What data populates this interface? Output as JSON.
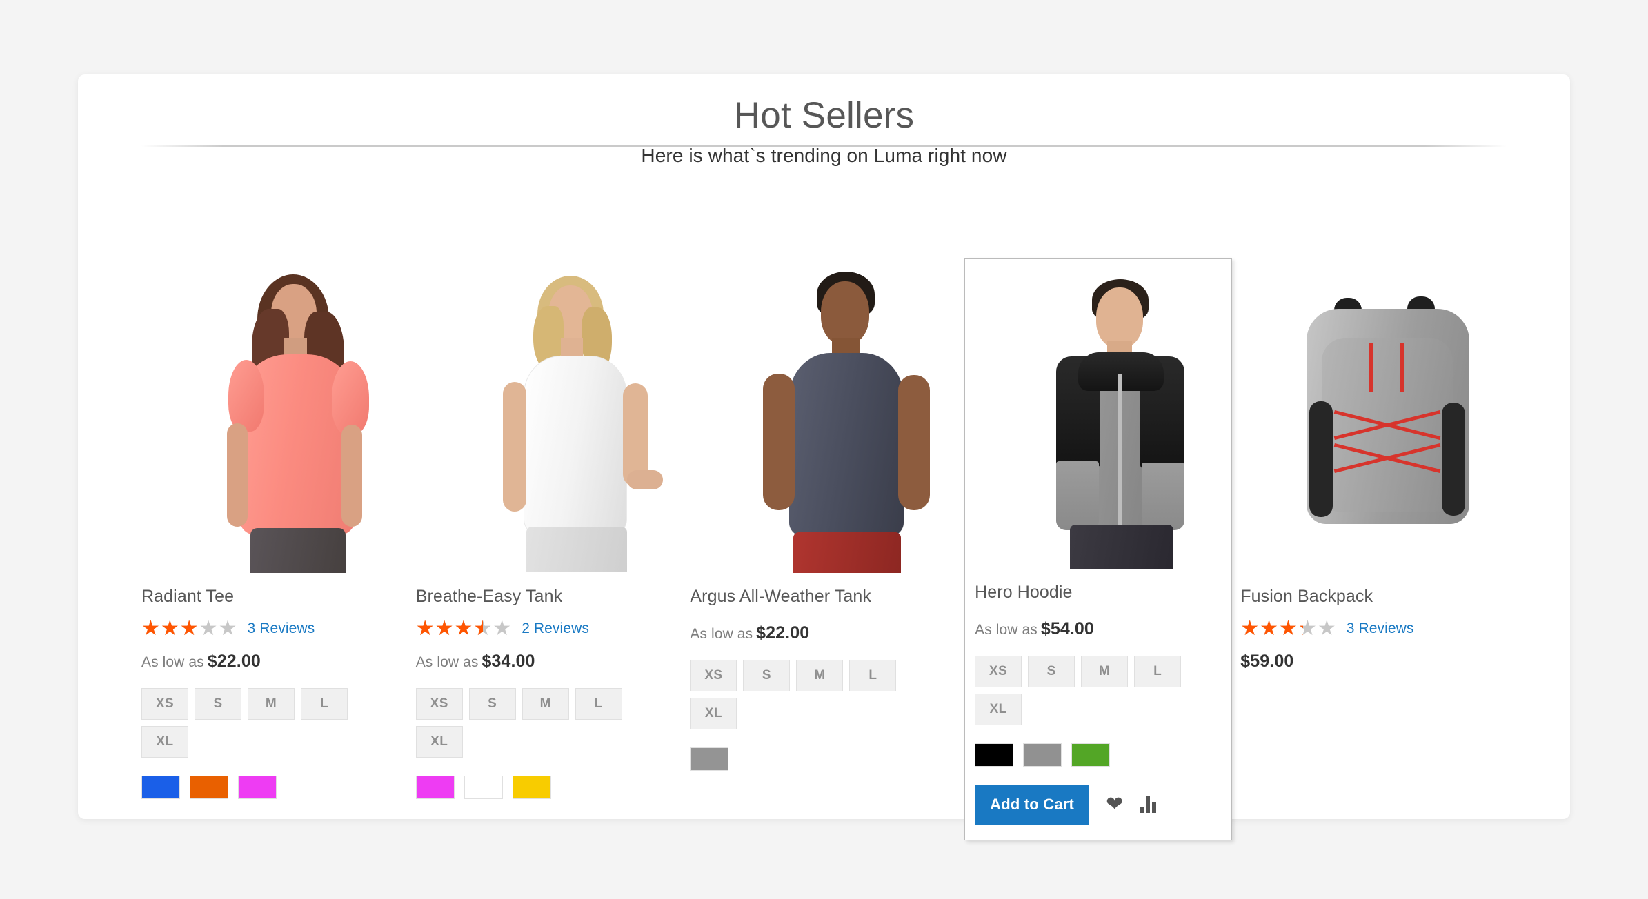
{
  "widget": {
    "title": "Hot Sellers",
    "subtitle": "Here is what`s trending on Luma right now"
  },
  "labels": {
    "as_low_as": "As low as",
    "reviews_suffix": "Reviews",
    "add_to_cart": "Add to Cart",
    "wishlist_icon": "heart-icon",
    "compare_icon": "compare-bars-icon"
  },
  "colors": {
    "accent_blue": "#1979c3",
    "star_orange": "#ff5501",
    "star_grey": "#c7c7c7",
    "link_blue": "#1979c3",
    "title_grey": "#575757",
    "page_bg": "#f4f4f4",
    "swatch_bg": "#f0f0f0"
  },
  "products": [
    {
      "name": "Radiant Tee",
      "rating_percent": 60,
      "review_count": "3",
      "has_rating": true,
      "price_label": "As low as",
      "price": "$22.00",
      "sizes": [
        "XS",
        "S",
        "M",
        "L",
        "XL"
      ],
      "colors": [
        "#1a5fe8",
        "#e96000",
        "#ee3cf3"
      ],
      "hovered": false
    },
    {
      "name": "Breathe-Easy Tank",
      "rating_percent": 70,
      "review_count": "2",
      "has_rating": true,
      "price_label": "As low as",
      "price": "$34.00",
      "sizes": [
        "XS",
        "S",
        "M",
        "L",
        "XL"
      ],
      "colors": [
        "#ee3cf3",
        "#ffffff",
        "#f8cc00"
      ],
      "hovered": false
    },
    {
      "name": "Argus All-Weather Tank",
      "rating_percent": 0,
      "review_count": "",
      "has_rating": false,
      "price_label": "As low as",
      "price": "$22.00",
      "sizes": [
        "XS",
        "S",
        "M",
        "L",
        "XL"
      ],
      "colors": [
        "#949494"
      ],
      "hovered": false
    },
    {
      "name": "Hero Hoodie",
      "rating_percent": 0,
      "review_count": "",
      "has_rating": false,
      "price_label": "As low as",
      "price": "$54.00",
      "sizes": [
        "XS",
        "S",
        "M",
        "L",
        "XL"
      ],
      "colors": [
        "#000000",
        "#919191",
        "#53a626"
      ],
      "hovered": true
    },
    {
      "name": "Fusion Backpack",
      "rating_percent": 65,
      "review_count": "3",
      "has_rating": true,
      "price_label": "",
      "price": "$59.00",
      "sizes": [],
      "colors": [],
      "hovered": false
    }
  ]
}
